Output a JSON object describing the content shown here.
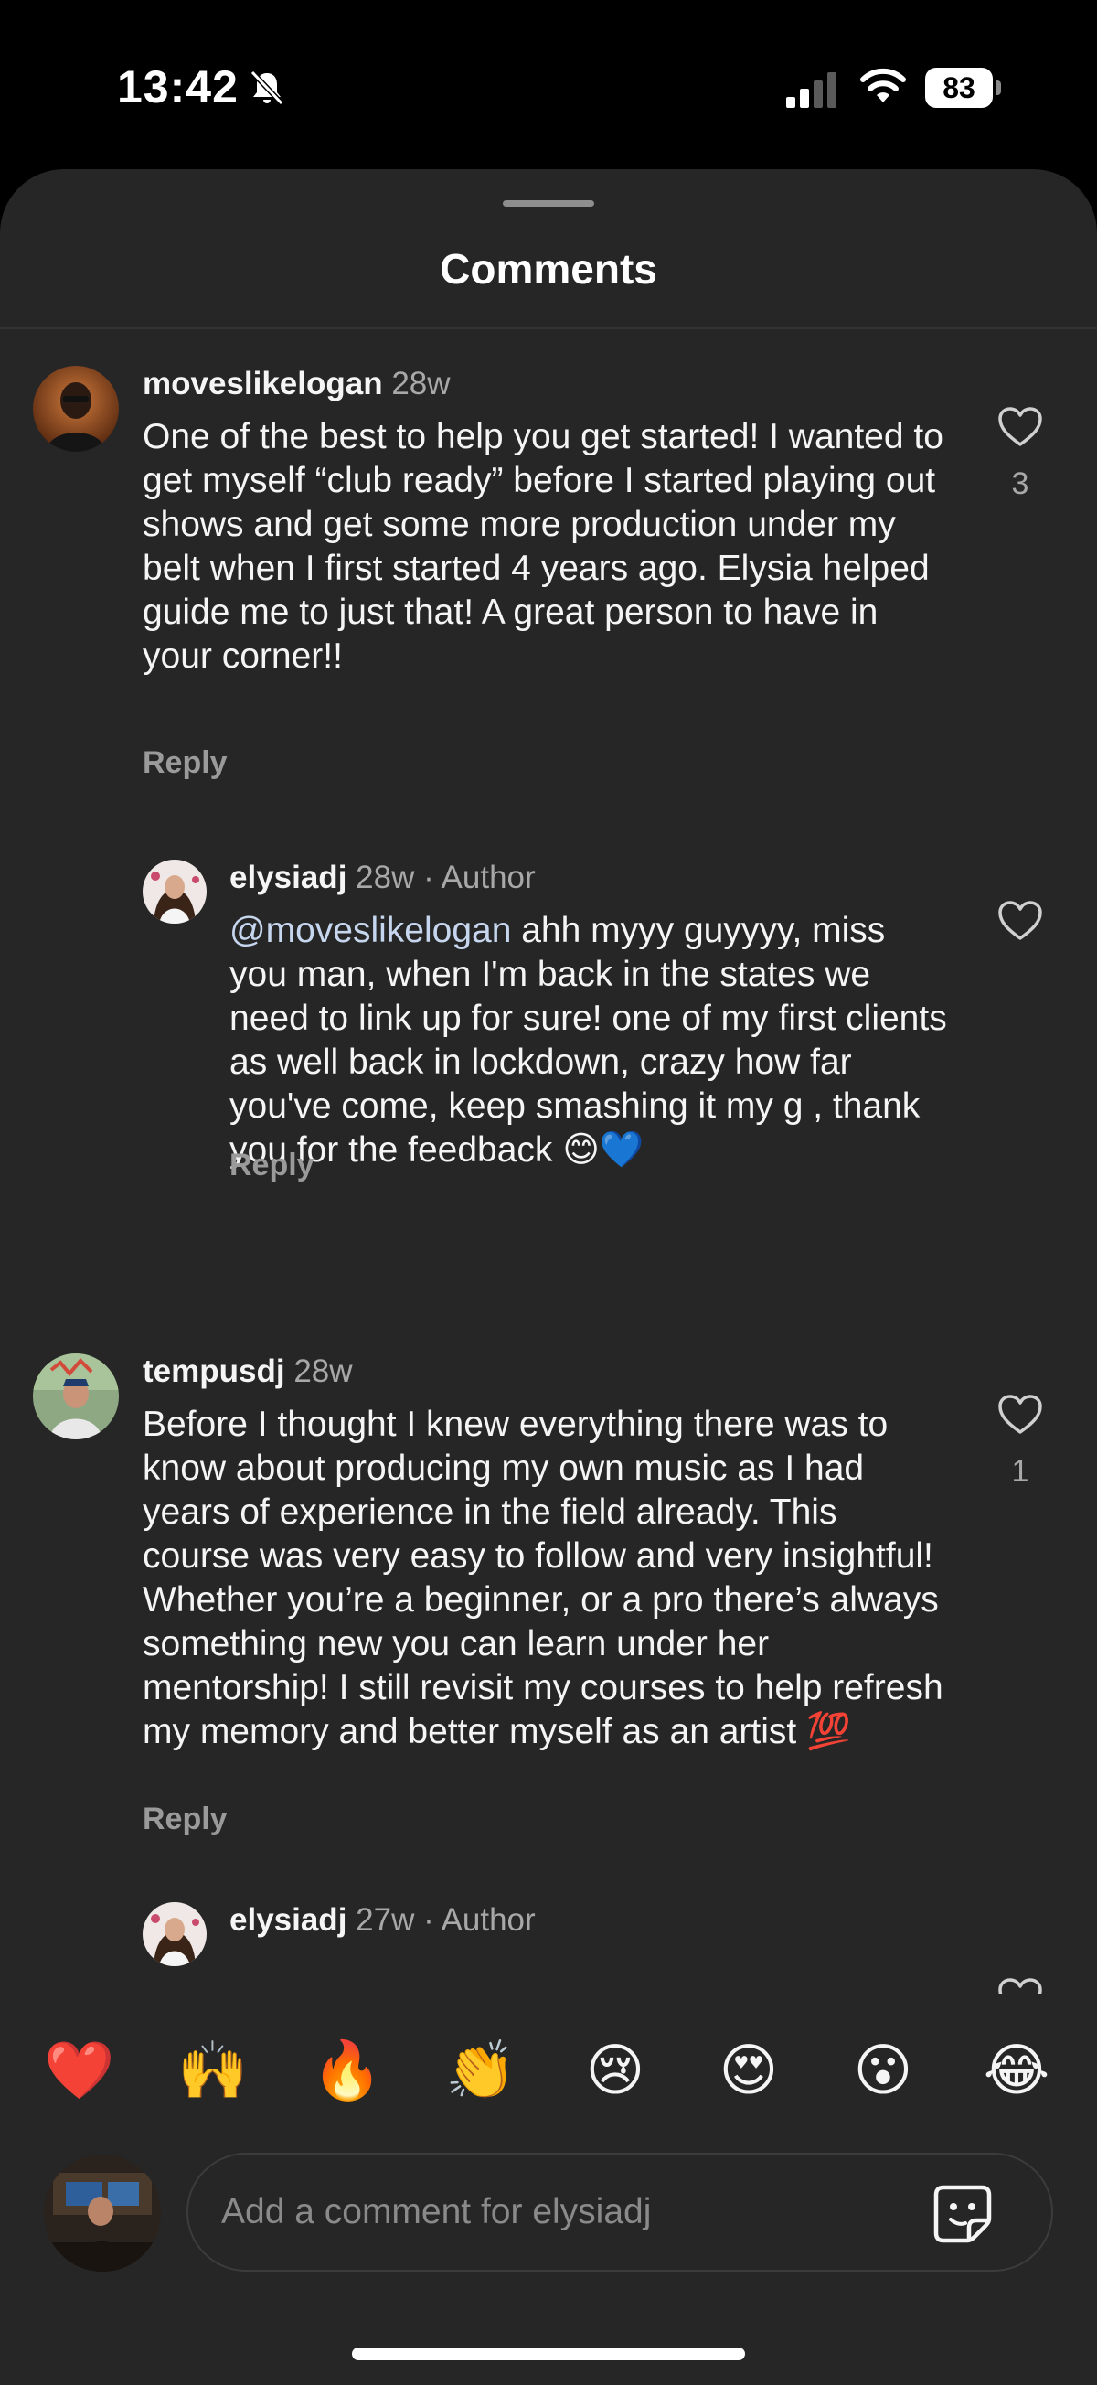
{
  "status_bar": {
    "time": "13:42",
    "battery": "83"
  },
  "sheet": {
    "title": "Comments"
  },
  "comments": [
    {
      "username": "moveslikelogan",
      "meta": "28w",
      "text": "One of the best to help you get started! I wanted to get myself “club ready” before I started playing out shows and get some more production under my belt when I first started 4 years ago. Elysia helped guide me to just that! A great  person to have in your corner!!",
      "reply_label": "Reply",
      "likes": "3"
    },
    {
      "username": "elysiadj",
      "meta": "28w · Author",
      "mention": "@moveslikelogan",
      "text": " ahh myyy guyyyy, miss you man, when I'm back in the states we need to link up for sure! one of my first clients as well back in lockdown, crazy how far you've come, keep smashing it my g , thank you for the feedback 😊💙",
      "reply_label": "Reply",
      "likes": ""
    },
    {
      "username": "tempusdj",
      "meta": "28w",
      "text": "Before I thought I knew everything there was to know about producing my own music as I had years of experience in the field already. This course was very easy to follow and very insightful! Whether you’re a beginner, or a pro there’s always something new you can learn under her mentorship! I still revisit my courses to help refresh my memory and better myself as an artist 💯",
      "reply_label": "Reply",
      "likes": "1"
    },
    {
      "username": "elysiadj",
      "meta": "27w · Author"
    }
  ],
  "quick_reactions": [
    "❤️",
    "🙌",
    "🔥",
    "👏",
    "😢",
    "😍",
    "😮",
    "😂"
  ],
  "composer": {
    "placeholder": "Add a comment for elysiadj"
  },
  "icons": {
    "mute": "bell-slash-icon",
    "signal": "cellular-signal-icon",
    "wifi": "wifi-icon",
    "like": "heart-outline-icon",
    "sticker": "sticker-icon"
  },
  "colors": {
    "background": "#262626",
    "mention": "#c6d6ee",
    "secondary_text": "#a8a8a8"
  }
}
